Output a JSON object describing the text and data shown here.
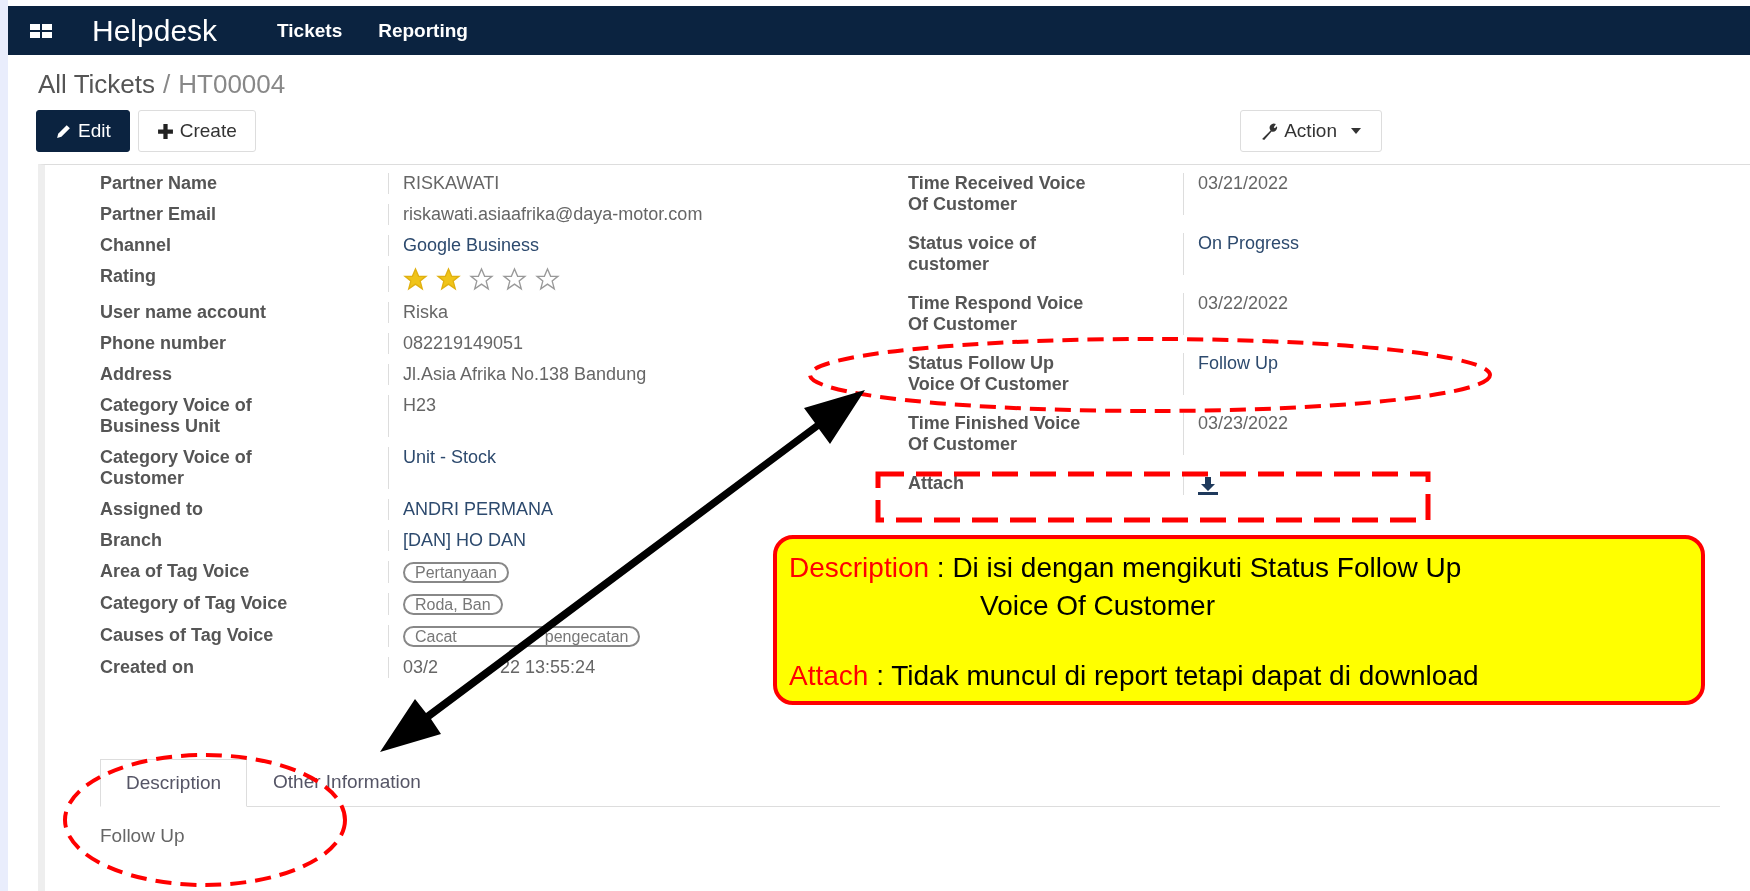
{
  "navbar": {
    "app": "Helpdesk",
    "menu": [
      "Tickets",
      "Reporting"
    ]
  },
  "breadcrumb": {
    "parent": "All Tickets",
    "separator": "/",
    "current": "HT00004"
  },
  "buttons": {
    "edit": "Edit",
    "create": "Create",
    "action": "Action"
  },
  "left_fields": [
    {
      "label": "Partner Name",
      "kind": "text",
      "value": "RISKAWATI"
    },
    {
      "label": "Partner Email",
      "kind": "text",
      "value": "riskawati.asiaafrika@daya-motor.com"
    },
    {
      "label": "Channel",
      "kind": "link",
      "value": "Google Business"
    },
    {
      "label": "Rating",
      "kind": "stars",
      "stars": 2
    },
    {
      "label": "User name account",
      "kind": "text",
      "value": "Riska"
    },
    {
      "label": "Phone number",
      "kind": "text",
      "value": "082219149051"
    },
    {
      "label": "Address",
      "kind": "text",
      "value": "Jl.Asia Afrika No.138 Bandung"
    },
    {
      "label": "Category Voice of Business Unit",
      "kind": "text",
      "value": "H23"
    },
    {
      "label": "Category Voice of Customer",
      "kind": "link",
      "value": "Unit - Stock"
    },
    {
      "label": "Assigned to",
      "kind": "link",
      "value": "ANDRI PERMANA"
    },
    {
      "label": "Branch",
      "kind": "link",
      "value": "[DAN] HO DAN"
    },
    {
      "label": "Area of Tag Voice",
      "kind": "tag",
      "parts": [
        "Pertanyaan"
      ]
    },
    {
      "label": "Category of Tag Voice",
      "kind": "tag",
      "parts": [
        "Roda, Ban"
      ]
    },
    {
      "label": "Causes of Tag Voice",
      "kind": "tag",
      "parts": [
        "Cacat",
        "pengecatan"
      ]
    },
    {
      "label": "Created on",
      "kind": "text",
      "parts": [
        "03/2",
        "22 13:55:24"
      ]
    }
  ],
  "right_fields": [
    {
      "label": "Time Received Voice Of Customer",
      "kind": "text",
      "value": "03/21/2022"
    },
    {
      "label": "Status voice of customer",
      "kind": "link",
      "value": "On Progress"
    },
    {
      "label": "Time Respond Voice Of Customer",
      "kind": "text",
      "value": "03/22/2022"
    },
    {
      "label": "Status Follow Up Voice Of Customer",
      "kind": "link",
      "value": "Follow Up"
    },
    {
      "label": "Time Finished Voice Of Customer",
      "kind": "text",
      "value": "03/23/2022"
    },
    {
      "label": "Attach",
      "kind": "download"
    }
  ],
  "tabs": [
    {
      "label": "Description",
      "selected": true
    },
    {
      "label": "Other Information",
      "selected": false
    }
  ],
  "tab_content": "Follow Up",
  "note": [
    {
      "label": "Description",
      "text": ": Di isi dengan mengikuti Status Follow Up",
      "continuation": "Voice Of Customer"
    },
    {
      "label": "Attach",
      "text": ": Tidak muncul di report tetapi dapat di download"
    }
  ]
}
